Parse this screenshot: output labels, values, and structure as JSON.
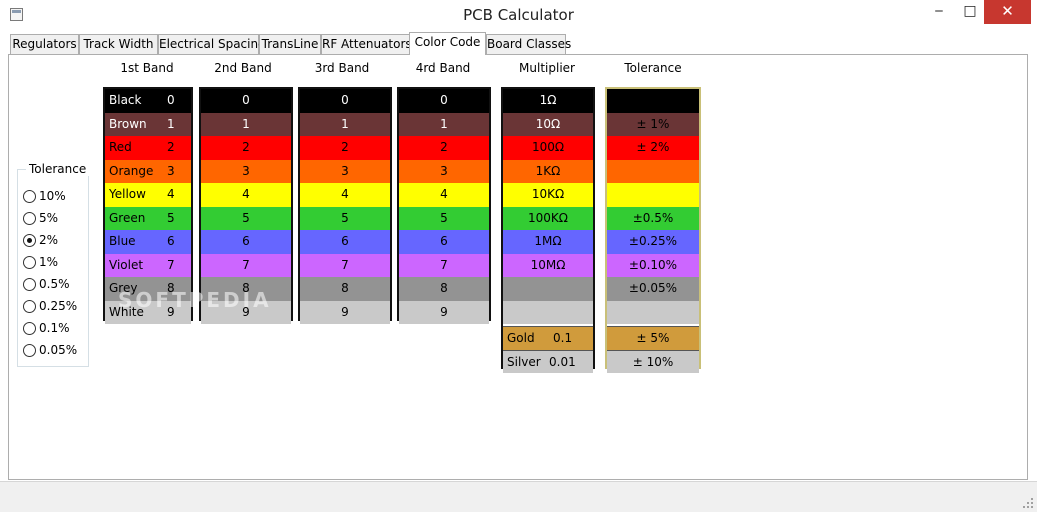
{
  "window": {
    "title": "PCB Calculator",
    "controls": {
      "minimize": "‒",
      "maximize": "□",
      "close": "✕"
    }
  },
  "tabs": [
    {
      "label": "Regulators",
      "active": false
    },
    {
      "label": "Track Width",
      "active": false
    },
    {
      "label": "Electrical Spacing",
      "active": false
    },
    {
      "label": "TransLine",
      "active": false
    },
    {
      "label": "RF Attenuators",
      "active": false
    },
    {
      "label": "Color Code",
      "active": true
    },
    {
      "label": "Board Classes",
      "active": false
    }
  ],
  "tolerance_selector": {
    "label": "Tolerance",
    "options": [
      "10%",
      "5%",
      "2%",
      "1%",
      "0.5%",
      "0.25%",
      "0.1%",
      "0.05%"
    ],
    "selected": "2%"
  },
  "color_table": {
    "headers": [
      "1st Band",
      "2nd Band",
      "3rd Band",
      "4rd Band",
      "Multiplier",
      "Tolerance"
    ],
    "colors": {
      "black": "#000000",
      "brown": "#6a3536",
      "red": "#ff0000",
      "orange": "#ff6600",
      "yellow": "#ffff00",
      "green": "#33cc33",
      "blue": "#6666ff",
      "violet": "#cc66ff",
      "grey": "#939393",
      "white": "#c9c9c9",
      "gold": "#d09b3c",
      "silver": "#c9c9c9"
    },
    "first_band": [
      {
        "name": "Black",
        "digit": "0"
      },
      {
        "name": "Brown",
        "digit": "1"
      },
      {
        "name": "Red",
        "digit": "2"
      },
      {
        "name": "Orange",
        "digit": "3"
      },
      {
        "name": "Yellow",
        "digit": "4"
      },
      {
        "name": "Green",
        "digit": "5"
      },
      {
        "name": "Blue",
        "digit": "6"
      },
      {
        "name": "Violet",
        "digit": "7"
      },
      {
        "name": "Grey",
        "digit": "8"
      },
      {
        "name": "White",
        "digit": "9"
      }
    ],
    "digit_bands": {
      "second": [
        "0",
        "1",
        "2",
        "3",
        "4",
        "5",
        "6",
        "7",
        "8",
        "9"
      ],
      "third": [
        "0",
        "1",
        "2",
        "3",
        "4",
        "5",
        "6",
        "7",
        "8",
        "9"
      ],
      "fourth": [
        "0",
        "1",
        "2",
        "3",
        "4",
        "5",
        "6",
        "7",
        "8",
        "9"
      ]
    },
    "multiplier": {
      "values": [
        "1Ω",
        "10Ω",
        "100Ω",
        "1KΩ",
        "10KΩ",
        "100KΩ",
        "1MΩ",
        "10MΩ",
        "",
        ""
      ],
      "gold": {
        "name": "Gold",
        "value": "0.1"
      },
      "silver": {
        "name": "Silver",
        "value": "0.01"
      }
    },
    "tolerance": {
      "values": [
        "",
        "±   1%",
        "±   2%",
        "",
        "",
        "±0.5%",
        "±0.25%",
        "±0.10%",
        "±0.05%",
        ""
      ],
      "gold": "±    5%",
      "silver": "±   10%"
    }
  },
  "watermark": "SOFTPEDIA"
}
